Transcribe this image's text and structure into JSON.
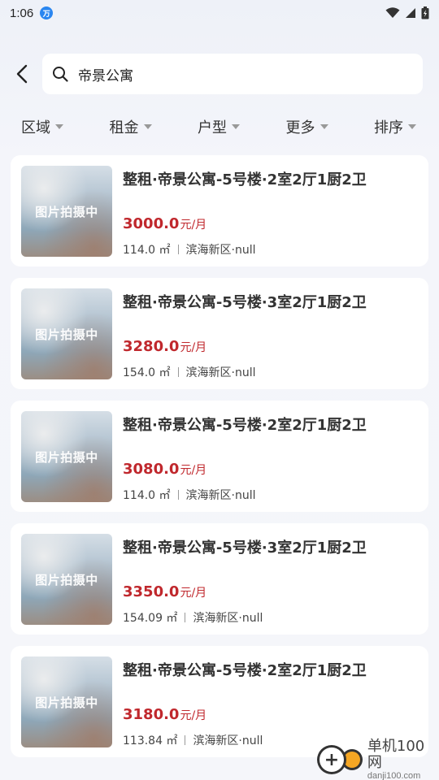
{
  "status_bar": {
    "time": "1:06",
    "app_icon_text": "万"
  },
  "search": {
    "query": "帝景公寓"
  },
  "filters": [
    {
      "label": "区域"
    },
    {
      "label": "租金"
    },
    {
      "label": "户型"
    },
    {
      "label": "更多"
    },
    {
      "label": "排序"
    }
  ],
  "listings": [
    {
      "placeholder": "图片拍摄中",
      "title": "整租·帝景公寓-5号楼·2室2厅1厨2卫",
      "price": "3000.0",
      "price_unit": "元/月",
      "area": "114.0 ㎡",
      "location": "滨海新区·null"
    },
    {
      "placeholder": "图片拍摄中",
      "title": "整租·帝景公寓-5号楼·3室2厅1厨2卫",
      "price": "3280.0",
      "price_unit": "元/月",
      "area": "154.0 ㎡",
      "location": "滨海新区·null"
    },
    {
      "placeholder": "图片拍摄中",
      "title": "整租·帝景公寓-5号楼·2室2厅1厨2卫",
      "price": "3080.0",
      "price_unit": "元/月",
      "area": "114.0 ㎡",
      "location": "滨海新区·null"
    },
    {
      "placeholder": "图片拍摄中",
      "title": "整租·帝景公寓-5号楼·3室2厅1厨2卫",
      "price": "3350.0",
      "price_unit": "元/月",
      "area": "154.09 ㎡",
      "location": "滨海新区·null"
    },
    {
      "placeholder": "图片拍摄中",
      "title": "整租·帝景公寓-5号楼·2室2厅1厨2卫",
      "price": "3180.0",
      "price_unit": "元/月",
      "area": "113.84 ㎡",
      "location": "滨海新区·null"
    }
  ],
  "watermark": {
    "name": "单机100网",
    "url": "danji100.com"
  },
  "colors": {
    "price": "#c0282d",
    "accent_blue": "#2a86f0"
  }
}
